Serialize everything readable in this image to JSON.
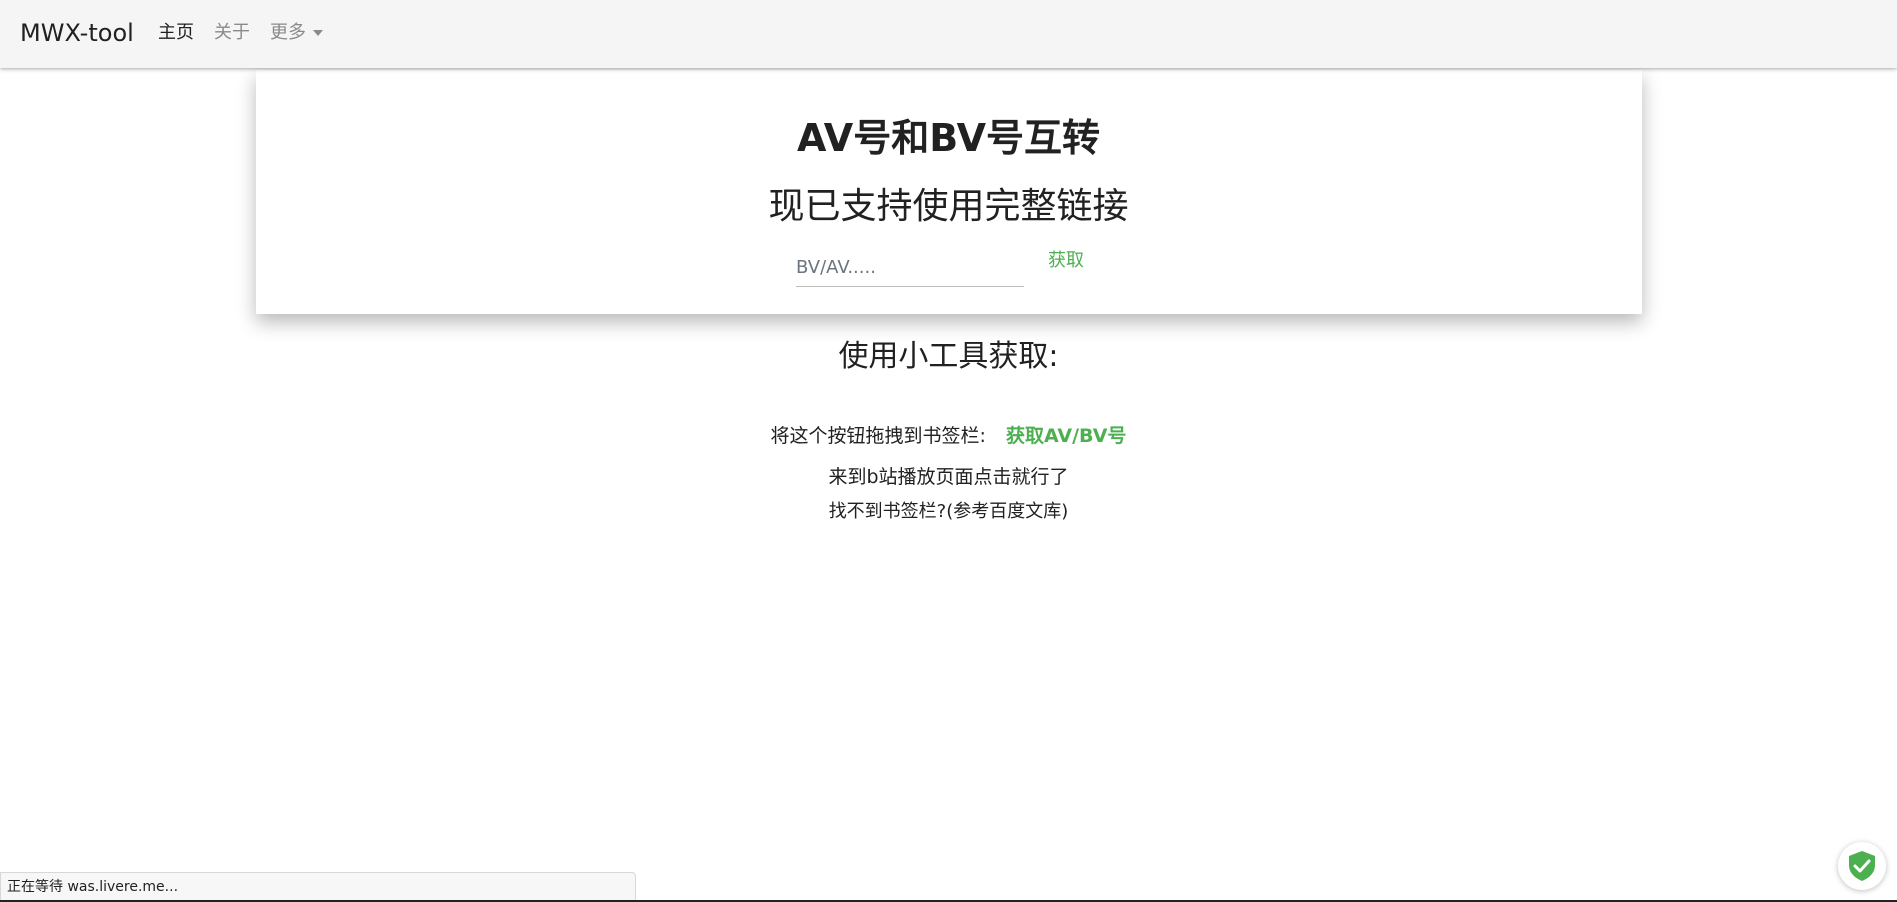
{
  "navbar": {
    "brand": "MWX-tool",
    "links": [
      {
        "label": "主页",
        "active": true
      },
      {
        "label": "关于",
        "active": false
      },
      {
        "label": "更多",
        "active": false,
        "dropdown": true
      }
    ]
  },
  "converter": {
    "title": "AV号和BV号互转",
    "subtitle": "现已支持使用完整链接",
    "input_placeholder": "BV/AV.....",
    "input_value": "",
    "fetch_label": "获取"
  },
  "tool_section": {
    "heading": "使用小工具获取:",
    "drag_label": "将这个按钮拖拽到书签栏:",
    "bookmarklet_label": "获取AV/BV号",
    "usage_hint": "来到b站播放页面点击就行了",
    "help_link": "找不到书签栏?(参考百度文库)"
  },
  "status_bar": {
    "text": "正在等待 was.livere.me..."
  },
  "colors": {
    "accent_green": "#4caf50",
    "navbar_bg": "#f5f5f5"
  },
  "icons": {
    "corner_badge": "shield-check-icon"
  }
}
